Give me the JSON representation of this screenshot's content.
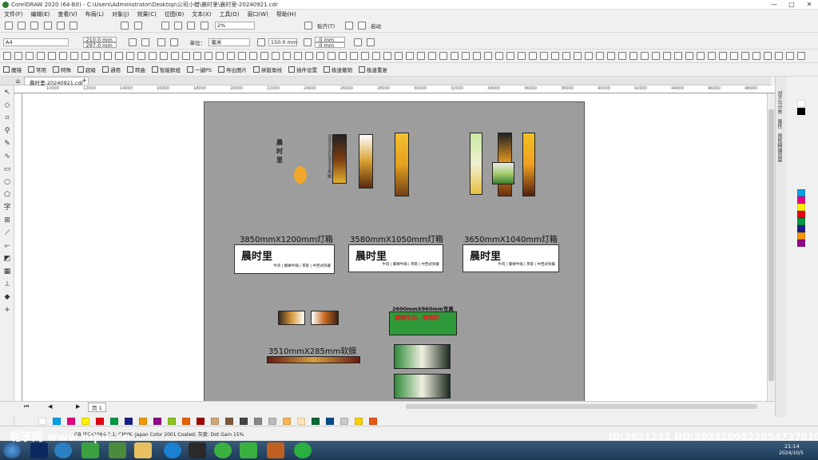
{
  "window": {
    "title": "CorelDRAW 2020 (64-Bit) - C:\\Users\\Administrator\\Desktop\\公司小蜡\\晨时里\\晨时里-20240921.cdr",
    "min": "—",
    "max": "□",
    "close": "✕"
  },
  "menu": [
    "文件(F)",
    "编辑(E)",
    "查看(V)",
    "布局(L)",
    "对象(J)",
    "效果(C)",
    "位图(B)",
    "文本(X)",
    "工具(O)",
    "窗口(W)",
    "帮助(H)"
  ],
  "toolbar": {
    "zoom": "2%",
    "snap_label": "贴齐(T)",
    "launch_label": "启动"
  },
  "propbar": {
    "page_size": "A4",
    "width": "210.0 mm",
    "height": "297.0 mm",
    "units_label": "单位：",
    "units": "毫米",
    "nudge": "150.0 mm",
    "dup_x": ".0 mm",
    "dup_y": ".0 mm"
  },
  "pluginbar": [
    "魔镜",
    "常用",
    "特殊",
    "超级",
    "通用",
    "转曲",
    "智能群组",
    "一键PS",
    "导出图片",
    "拼版角线",
    "插件设置",
    "极速撤销",
    "极速重复"
  ],
  "doc_tab": "晨时里-20240921.cdr",
  "ruler_marks": [
    "10000",
    "12000",
    "14000",
    "16000",
    "18000",
    "20000",
    "22000",
    "24000",
    "26000",
    "28000",
    "30000",
    "32000",
    "34000",
    "36000",
    "38000",
    "40000",
    "42000",
    "44000",
    "46000",
    "48000",
    "50000"
  ],
  "design": {
    "sign_labels": [
      "3850mmX1200mm灯箱",
      "3580mmX1050mm灯箱",
      "3650mmX1040mm灯箱"
    ],
    "sign_logo": "晨时里",
    "sign_text": "牛肉 | 螺蛳牛腩 | 茶歇 | 中西式快餐",
    "soft_film_label": "3510mmX285mm软膜",
    "photo_label": "2600mmX960mm写真",
    "green_banner_text": "螺蛳牛杂、螺蛳粉",
    "vertical_banner_label": "500mmX2000mm吊旗"
  },
  "docker_tabs": [
    "对齐与分布",
    "属性",
    "图框精确剪裁"
  ],
  "page_nav": {
    "page": "页 1"
  },
  "status": {
    "color_profile": "GB IEC61966-2.1; CMYK: Japan Color 2001 Coated; 灰度: Dot Gain 15%"
  },
  "watermark": {
    "left": "昵享网 www.nipic.cn",
    "right": "ID:2621221 NO:20241005220547378102"
  },
  "clock": {
    "time": "21:14",
    "date": "2024/10/5"
  },
  "colors": {
    "accent": "#2f7d32",
    "page_bg": "#9d9d9d"
  }
}
